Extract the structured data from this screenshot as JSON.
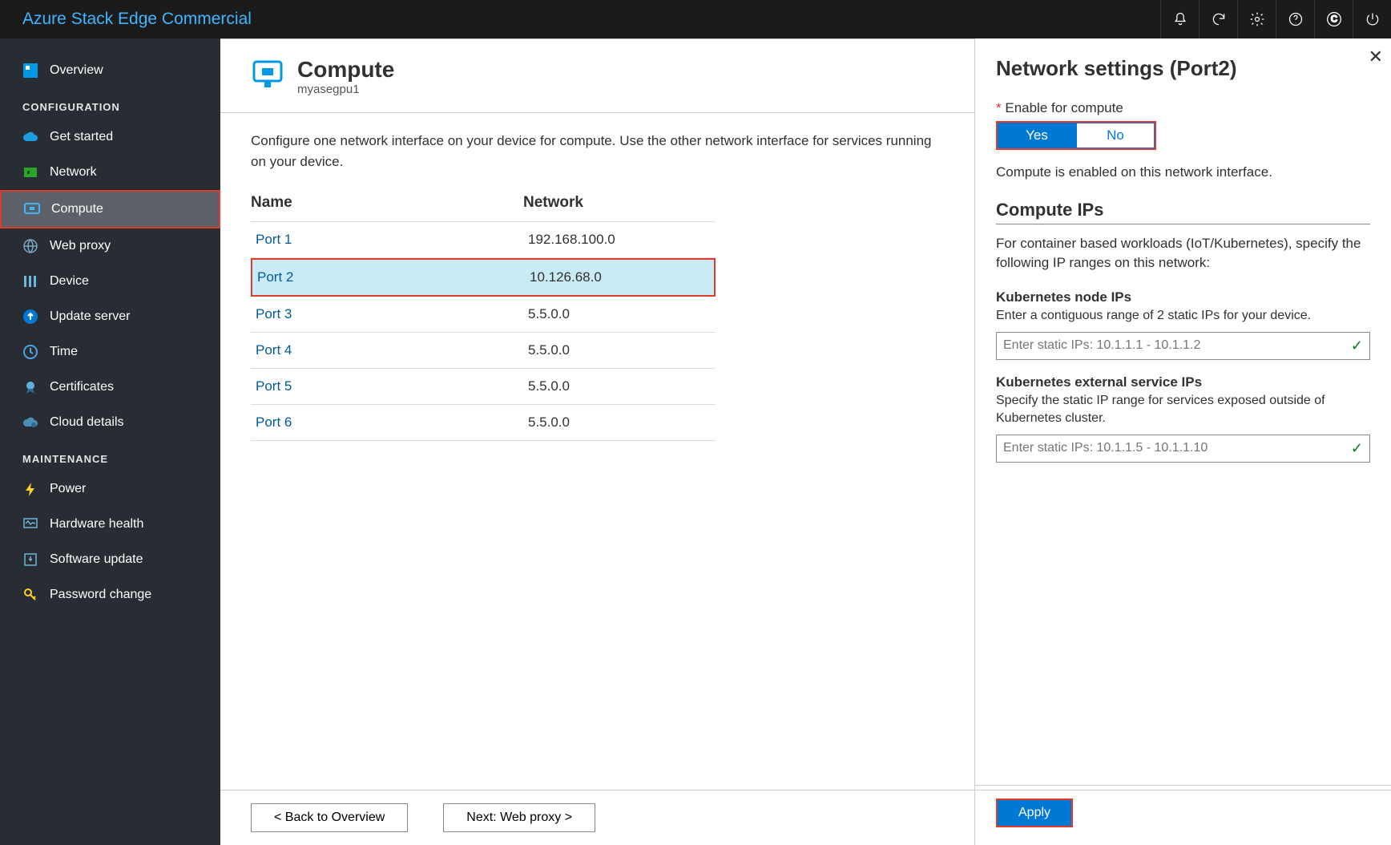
{
  "brand": "Azure Stack Edge Commercial",
  "sidebar": {
    "overview_label": "Overview",
    "section_config": "CONFIGURATION",
    "section_maint": "MAINTENANCE",
    "items_config": [
      {
        "label": "Get started"
      },
      {
        "label": "Network"
      },
      {
        "label": "Compute"
      },
      {
        "label": "Web proxy"
      },
      {
        "label": "Device"
      },
      {
        "label": "Update server"
      },
      {
        "label": "Time"
      },
      {
        "label": "Certificates"
      },
      {
        "label": "Cloud details"
      }
    ],
    "items_maint": [
      {
        "label": "Power"
      },
      {
        "label": "Hardware health"
      },
      {
        "label": "Software update"
      },
      {
        "label": "Password change"
      }
    ]
  },
  "page": {
    "title": "Compute",
    "subtitle": "myasegpu1",
    "intro": "Configure one network interface on your device for compute. Use the other network interface for services running on your device."
  },
  "ports": {
    "col_name": "Name",
    "col_net": "Network",
    "rows": [
      {
        "name": "Port 1",
        "net": "192.168.100.0"
      },
      {
        "name": "Port 2",
        "net": "10.126.68.0"
      },
      {
        "name": "Port 3",
        "net": "5.5.0.0"
      },
      {
        "name": "Port 4",
        "net": "5.5.0.0"
      },
      {
        "name": "Port 5",
        "net": "5.5.0.0"
      },
      {
        "name": "Port 6",
        "net": "5.5.0.0"
      }
    ]
  },
  "footer": {
    "back": "< Back to Overview",
    "next": "Next: Web proxy >"
  },
  "panel": {
    "title": "Network settings (Port2)",
    "enable_label": "Enable for compute",
    "yes": "Yes",
    "no": "No",
    "enabled_msg": "Compute is enabled on this network interface.",
    "compute_ips": "Compute IPs",
    "ips_intro": "For container based workloads (IoT/Kubernetes), specify the following IP ranges on this network:",
    "k8s_node_label": "Kubernetes node IPs",
    "k8s_node_desc": "Enter a contiguous range of 2 static IPs for your device.",
    "k8s_node_placeholder": "Enter static IPs: 10.1.1.1 - 10.1.1.2",
    "k8s_ext_label": "Kubernetes external service IPs",
    "k8s_ext_desc": "Specify the static IP range for services exposed outside of Kubernetes cluster.",
    "k8s_ext_placeholder": "Enter static IPs: 10.1.1.5 - 10.1.1.10",
    "apply": "Apply"
  }
}
